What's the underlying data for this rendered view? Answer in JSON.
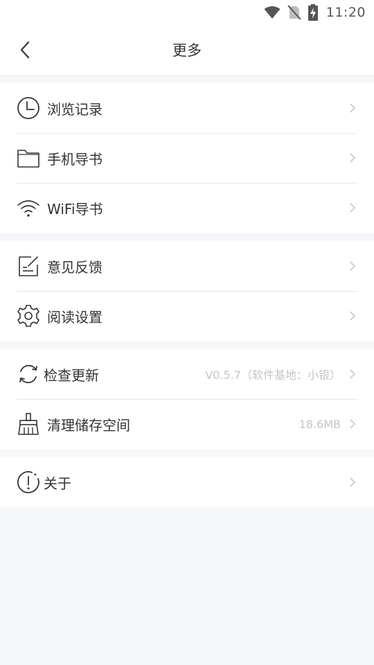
{
  "status": {
    "time": "11:20"
  },
  "header": {
    "title": "更多"
  },
  "groups": [
    {
      "items": [
        {
          "label": "浏览记录",
          "icon": "clock-icon"
        },
        {
          "label": "手机导书",
          "icon": "folder-icon"
        },
        {
          "label": "WiFi导书",
          "icon": "wifi-icon"
        }
      ]
    },
    {
      "items": [
        {
          "label": "意见反馈",
          "icon": "feedback-icon"
        },
        {
          "label": "阅读设置",
          "icon": "gear-icon"
        }
      ]
    },
    {
      "items": [
        {
          "label": "检查更新",
          "icon": "refresh-icon",
          "value": "V0.5.7（软件基地：小银）"
        },
        {
          "label": "清理储存空间",
          "icon": "broom-icon",
          "value": "18.6MB"
        }
      ]
    },
    {
      "items": [
        {
          "label": "关于",
          "icon": "info-icon"
        }
      ]
    }
  ],
  "colors": {
    "background": "#f6f7f9",
    "card": "#ffffff",
    "text": "#333333",
    "muted": "#c4c4c4"
  }
}
